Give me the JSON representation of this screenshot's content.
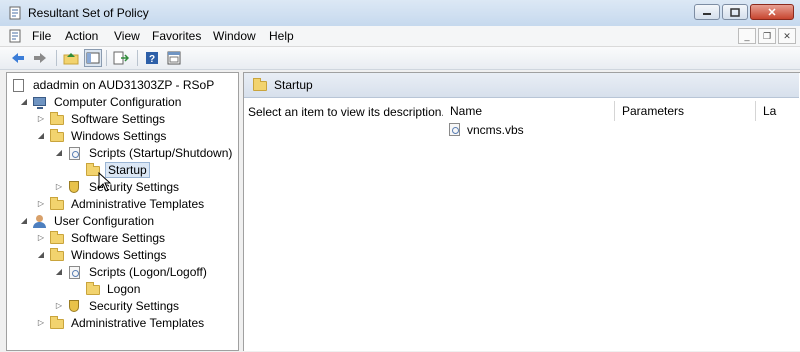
{
  "window": {
    "title": "Resultant Set of Policy"
  },
  "menu": [
    "File",
    "Action",
    "View",
    "Favorites",
    "Window",
    "Help"
  ],
  "tree": {
    "root": "adadmin on AUD31303ZP - RSoP",
    "computer": "Computer Configuration",
    "c_software": "Software Settings",
    "c_windows": "Windows Settings",
    "c_scripts": "Scripts (Startup/Shutdown)",
    "c_startup": "Startup",
    "c_security": "Security Settings",
    "c_admin": "Administrative Templates",
    "user": "User Configuration",
    "u_software": "Software Settings",
    "u_windows": "Windows Settings",
    "u_scripts": "Scripts (Logon/Logoff)",
    "u_logon": "Logon",
    "u_security": "Security Settings",
    "u_admin": "Administrative Templates"
  },
  "details": {
    "header": "Startup",
    "description": "Select an item to view its description.",
    "columns": [
      "Name",
      "Parameters",
      "La"
    ],
    "items": [
      "vncms.vbs"
    ]
  },
  "icons": [
    "app-icon",
    "back-arrow-icon",
    "forward-arrow-icon",
    "up-folder-icon",
    "show-hide-tree-icon",
    "export-list-icon",
    "help-icon",
    "properties-icon",
    "folder-icon",
    "script-icon",
    "shield-icon",
    "computer-icon",
    "user-icon",
    "rsop-icon",
    "mouse-cursor-icon"
  ],
  "colors": {
    "selection": "#dbe7f5",
    "folder": "#f2d36e",
    "close": "#c7452f"
  }
}
